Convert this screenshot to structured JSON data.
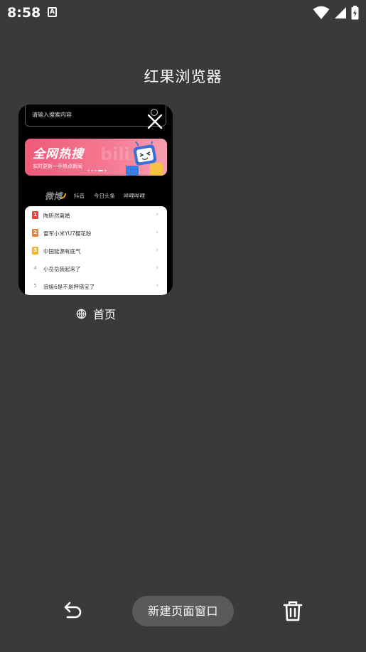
{
  "status_bar": {
    "time": "8:58",
    "icons": [
      "keyboard-a-icon",
      "wifi-icon",
      "signal-icon",
      "battery-charging-icon"
    ]
  },
  "app": {
    "title": "红果浏览器"
  },
  "tab_card": {
    "search_placeholder": "请输入搜索内容",
    "banner": {
      "title": "全网热搜",
      "subtitle": "实时更新一手热点新闻",
      "watermark": "bili"
    },
    "tabs": [
      "微博",
      "抖音",
      "今日头条",
      "哔哩哔哩"
    ],
    "hot_list": [
      {
        "rank": "1",
        "text": "陶昕然离婚",
        "color": "#e8443a"
      },
      {
        "rank": "2",
        "text": "雷军小米YU7樱花粉",
        "color": "#f08236"
      },
      {
        "rank": "3",
        "text": "中国能源有底气",
        "color": "#f5b32a"
      },
      {
        "rank": "4",
        "text": "小岳岳装起来了",
        "color": ""
      },
      {
        "rank": "5",
        "text": "浪姐6是不是押错宝了",
        "color": ""
      }
    ],
    "caption": "首页"
  },
  "toolbar": {
    "new_tab_label": "新建页面窗口"
  },
  "colors": {
    "background": "#3a3a3a",
    "pill": "#5a5a5a",
    "banner": "#ef5a7a"
  }
}
